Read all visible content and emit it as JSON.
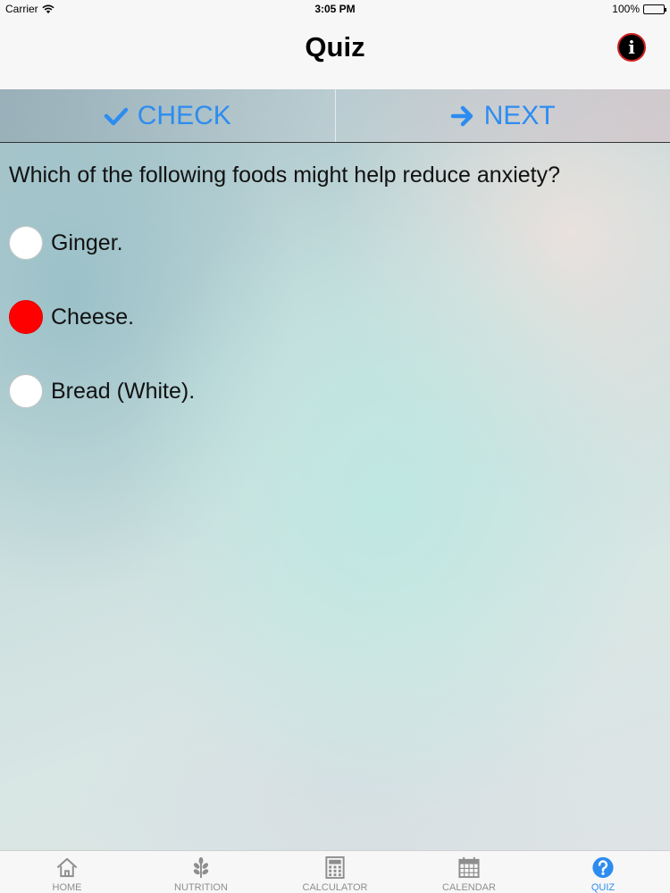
{
  "status_bar": {
    "carrier": "Carrier",
    "time": "3:05 PM",
    "battery": "100%",
    "battery_level": 1.0
  },
  "nav": {
    "title": "Quiz",
    "info_icon": "i"
  },
  "toolbar": {
    "check_label": "CHECK",
    "next_label": "NEXT",
    "accent_color": "#2d8cf0"
  },
  "quiz": {
    "question": "Which of the following foods might help reduce anxiety?",
    "options": [
      {
        "label": "Ginger.",
        "selected": false
      },
      {
        "label": "Cheese.",
        "selected": true
      },
      {
        "label": "Bread (White).",
        "selected": false
      }
    ],
    "selected_color": "#ff0000"
  },
  "tabs": [
    {
      "label": "HOME",
      "icon": "home-icon",
      "active": false
    },
    {
      "label": "NUTRITION",
      "icon": "leaf-icon",
      "active": false
    },
    {
      "label": "CALCULATOR",
      "icon": "calculator-icon",
      "active": false
    },
    {
      "label": "CALENDAR",
      "icon": "calendar-icon",
      "active": false
    },
    {
      "label": "QUIZ",
      "icon": "question-icon",
      "active": true
    }
  ]
}
